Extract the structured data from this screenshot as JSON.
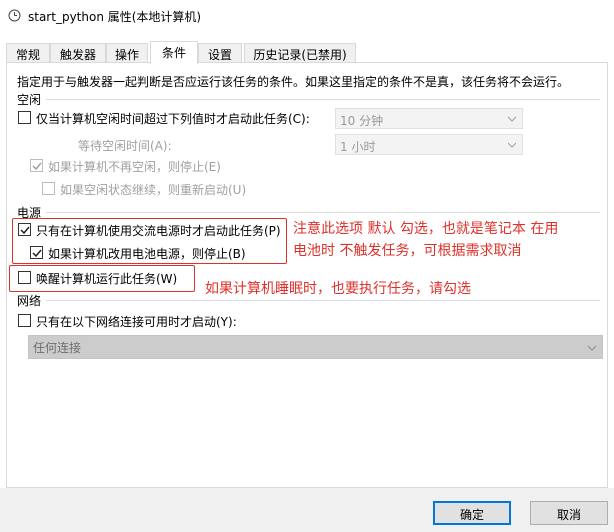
{
  "window": {
    "title": "start_python 属性(本地计算机)"
  },
  "tabs": [
    {
      "label": "常规"
    },
    {
      "label": "触发器"
    },
    {
      "label": "操作"
    },
    {
      "label": "条件"
    },
    {
      "label": "设置"
    },
    {
      "label": "历史记录(已禁用)"
    }
  ],
  "description": "指定用于与触发器一起判断是否应运行该任务的条件。如果这里指定的条件不是真，该任务将不会运行。",
  "idle": {
    "title": "空闲",
    "start_if_idle": {
      "label": "仅当计算机空闲时间超过下列值时才启动此任务(C):",
      "checked": false
    },
    "idle_duration": "10 分钟",
    "wait_label": "等待空闲时间(A):",
    "wait_duration": "1 小时",
    "stop_if_not_idle": {
      "label": "如果计算机不再空闲，则停止(E)",
      "checked": true
    },
    "restart_if_idle_resumes": {
      "label": "如果空闲状态继续，则重新启动(U)",
      "checked": false
    }
  },
  "power": {
    "title": "电源",
    "ac_only": {
      "label": "只有在计算机使用交流电源时才启动此任务(P)",
      "checked": true
    },
    "stop_on_battery": {
      "label": "如果计算机改用电池电源，则停止(B)",
      "checked": true
    },
    "wake_to_run": {
      "label": "唤醒计算机运行此任务(W)",
      "checked": false
    }
  },
  "network": {
    "title": "网络",
    "only_if_network": {
      "label": "只有在以下网络连接可用时才启动(Y):",
      "checked": false
    },
    "connection": "任何连接"
  },
  "annotations": {
    "power_note_line1": "注意此选项 默认 勾选，也就是笔记本 在用",
    "power_note_line2": "电池时 不触发任务，可根据需求取消",
    "wake_note": "如果计算机睡眠时，也要执行任务，请勾选"
  },
  "buttons": {
    "ok": "确定",
    "cancel": "取消"
  },
  "colors": {
    "annotation": "#e0302a",
    "default_button_border": "#0078d7"
  }
}
